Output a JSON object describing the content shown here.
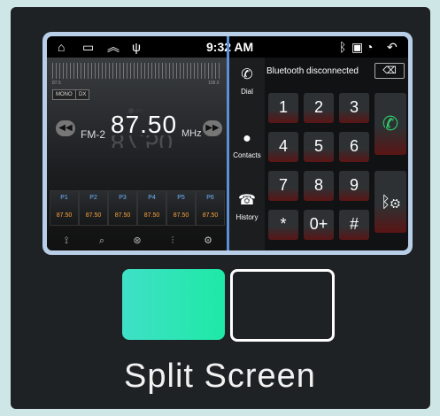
{
  "statusbar": {
    "time": "9:32 AM",
    "icons_left": [
      "home-icon",
      "window-icon",
      "chevrons-up-icon",
      "usb-icon"
    ],
    "icons_right": [
      "bluetooth-icon",
      "sd-card-icon",
      "wifi-icon",
      "back-icon"
    ]
  },
  "radio": {
    "scale_min": "87.5",
    "scale_max": "108.0",
    "chips": [
      "MONO",
      "DX"
    ],
    "band": "FM-2",
    "frequency": "87.50",
    "frequency_reflect": "87.50",
    "unit": "MHz",
    "presets": [
      {
        "label": "P1",
        "freq": "87.50"
      },
      {
        "label": "P2",
        "freq": "87.50"
      },
      {
        "label": "P3",
        "freq": "87.50"
      },
      {
        "label": "P4",
        "freq": "87.50"
      },
      {
        "label": "P5",
        "freq": "87.50"
      },
      {
        "label": "P6",
        "freq": "87.50"
      }
    ]
  },
  "dialer": {
    "status": "Bluetooth disconnected",
    "side": [
      {
        "label": "Dial",
        "icon": "phone-icon"
      },
      {
        "label": "Contacts",
        "icon": "person-icon"
      },
      {
        "label": "History",
        "icon": "call-history-icon"
      }
    ],
    "keys": [
      "1",
      "2",
      "3",
      "4",
      "5",
      "6",
      "7",
      "8",
      "9",
      "*",
      "0+",
      "#"
    ]
  },
  "caption": "Split Screen",
  "colors": {
    "accent_green": "#1ee9a6",
    "preset_orange": "#ffa53a",
    "preset_blue": "#6fb2ff",
    "divider_blue": "#5b8fd6"
  }
}
